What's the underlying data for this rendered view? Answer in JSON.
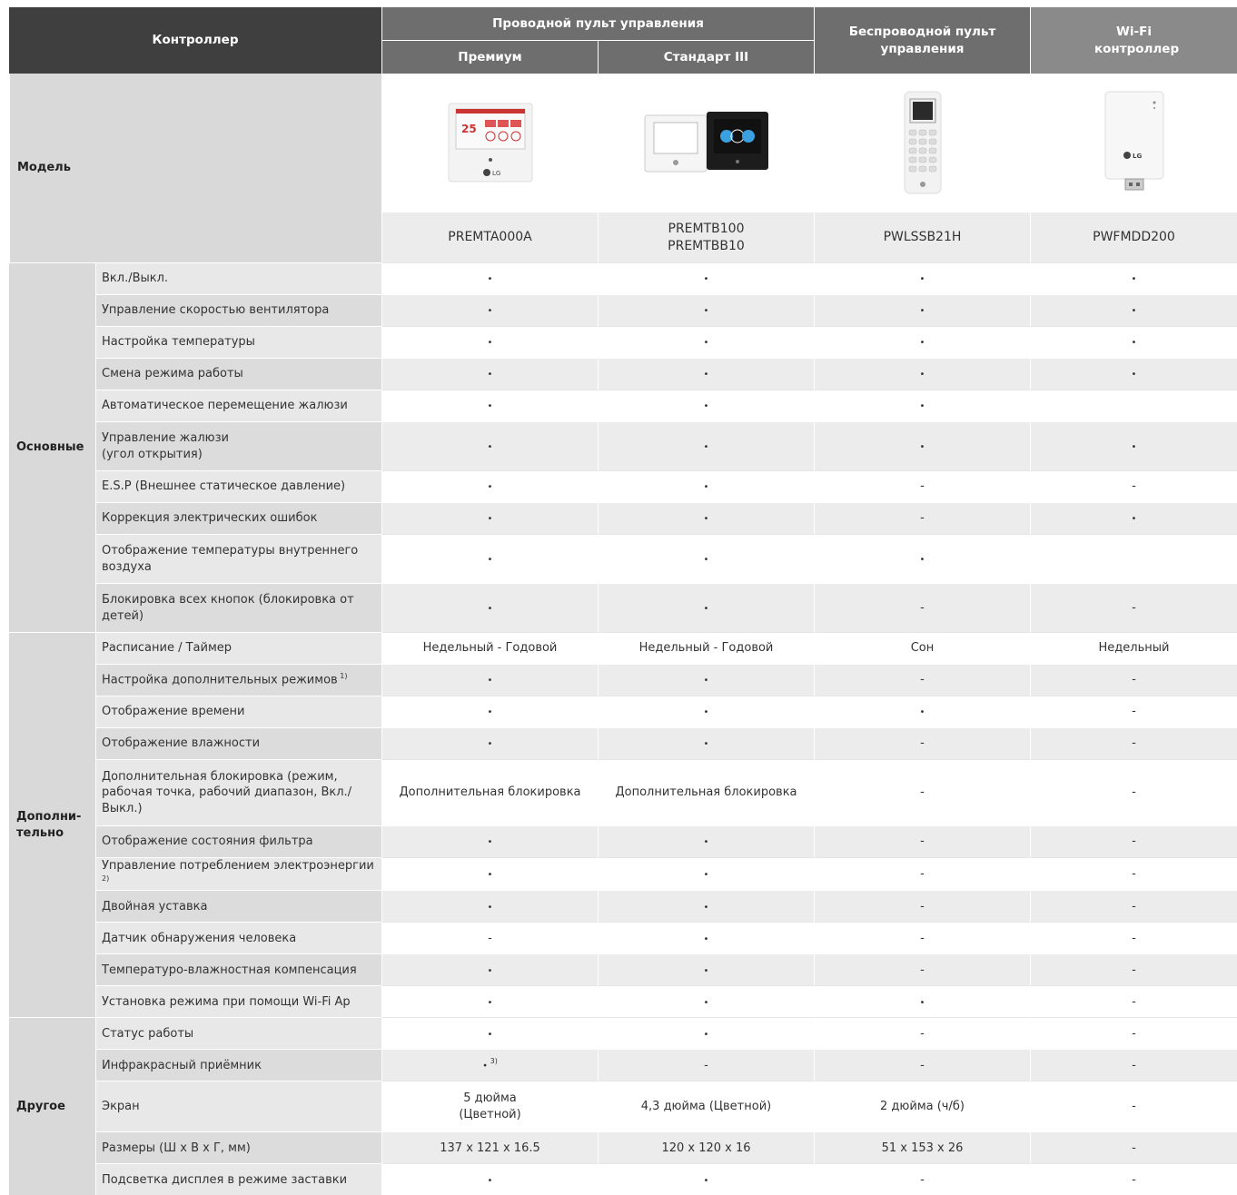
{
  "header": {
    "controller": "Контроллер",
    "wired": "Проводной пульт управления",
    "premium": "Премиум",
    "standard": "Стандарт III",
    "wireless": "Беспроводной пульт управления",
    "wifi": "Wi-Fi контроллер"
  },
  "model": {
    "label": "Модель",
    "codes": [
      "PREMTA000A",
      "PREMTB100\nPREMTBB10",
      "PWLSSB21H",
      "PWFMDD200"
    ],
    "code_b_line1": "PREMTB100",
    "code_b_line2": "PREMTBB10"
  },
  "categories": {
    "basic": "Основные",
    "additional": "Дополни-тельно",
    "other": "Другое"
  },
  "basic_rows": [
    {
      "feature": "Вкл./Выкл.",
      "values": [
        "•",
        "•",
        "•",
        "•"
      ]
    },
    {
      "feature": "Управление скоростью вентилятора",
      "values": [
        "•",
        "•",
        "•",
        "•"
      ]
    },
    {
      "feature": "Настройка температуры",
      "values": [
        "•",
        "•",
        "•",
        "•"
      ]
    },
    {
      "feature": "Смена режима работы",
      "values": [
        "•",
        "•",
        "•",
        "•"
      ]
    },
    {
      "feature": "Автоматическое перемещение жалюзи",
      "values": [
        "•",
        "•",
        "•",
        ""
      ]
    },
    {
      "feature": "Управление жалюзи\n(угол открытия)",
      "values": [
        "•",
        "•",
        "•",
        "•"
      ]
    },
    {
      "feature": "E.S.P (Внешнее статическое давление)",
      "values": [
        "•",
        "•",
        "-",
        "-"
      ]
    },
    {
      "feature": "Коррекция электрических ошибок",
      "values": [
        "•",
        "•",
        "-",
        "•"
      ]
    },
    {
      "feature": "Отображение температуры внутреннего воздуха",
      "values": [
        "•",
        "•",
        "•",
        ""
      ]
    },
    {
      "feature": "Блокировка всех кнопок (блокировка от детей)",
      "values": [
        "•",
        "•",
        "-",
        "-"
      ]
    }
  ],
  "additional_rows": [
    {
      "feature": "Расписание / Таймер",
      "values": [
        "Недельный - Годовой",
        "Недельный - Годовой",
        "Сон",
        "Недельный"
      ]
    },
    {
      "feature": "Настройка дополнительных режимов",
      "sup": "1)",
      "values": [
        "•",
        "•",
        "-",
        "-"
      ]
    },
    {
      "feature": "Отображение времени",
      "values": [
        "•",
        "•",
        "•",
        "-"
      ]
    },
    {
      "feature": "Отображение влажности",
      "values": [
        "•",
        "•",
        "-",
        "-"
      ]
    },
    {
      "feature": "Дополнительная блокировка (режим, рабочая точка, рабочий диапазон, Вкл./Выкл.)",
      "values": [
        "Дополнительная блокировка",
        "Дополнительная блокировка",
        "-",
        "-"
      ]
    },
    {
      "feature": "Отображение состояния фильтра",
      "values": [
        "•",
        "•",
        "-",
        "-"
      ]
    },
    {
      "feature": "Управление потреблением электроэнергии",
      "sup": "2)",
      "values": [
        "•",
        "•",
        "-",
        "-"
      ]
    },
    {
      "feature": "Двойная уставка",
      "values": [
        "•",
        "•",
        "-",
        "-"
      ]
    },
    {
      "feature": "Датчик обнаружения человека",
      "values": [
        "-",
        "•",
        "-",
        "-"
      ]
    },
    {
      "feature": "Температуро-влажностная компенсация",
      "values": [
        "•",
        "•",
        "-",
        "-"
      ]
    },
    {
      "feature": "Установка режима при помощи Wi-Fi Ap",
      "values": [
        "•",
        "•",
        "•",
        "-"
      ]
    }
  ],
  "other_rows": [
    {
      "feature": "Статус работы",
      "values": [
        "•",
        "•",
        "-",
        "-"
      ]
    },
    {
      "feature": "Инфракрасный приёмник",
      "values": [
        "• 3)",
        "-",
        "-",
        "-"
      ]
    },
    {
      "feature": "Экран",
      "values": [
        "5 дюйма\n(Цветной)",
        "4,3 дюйма (Цветной)",
        "2 дюйма (ч/б)",
        "-"
      ]
    },
    {
      "feature": "Размеры (Ш х В х Г, мм)",
      "values": [
        "137 x 121 x 16.5",
        "120 x 120 x 16",
        "51 x 153 x 26",
        "-"
      ]
    },
    {
      "feature": "Подсветка дисплея в режиме заставки",
      "values": [
        "•",
        "•",
        "-",
        "-"
      ]
    }
  ]
}
